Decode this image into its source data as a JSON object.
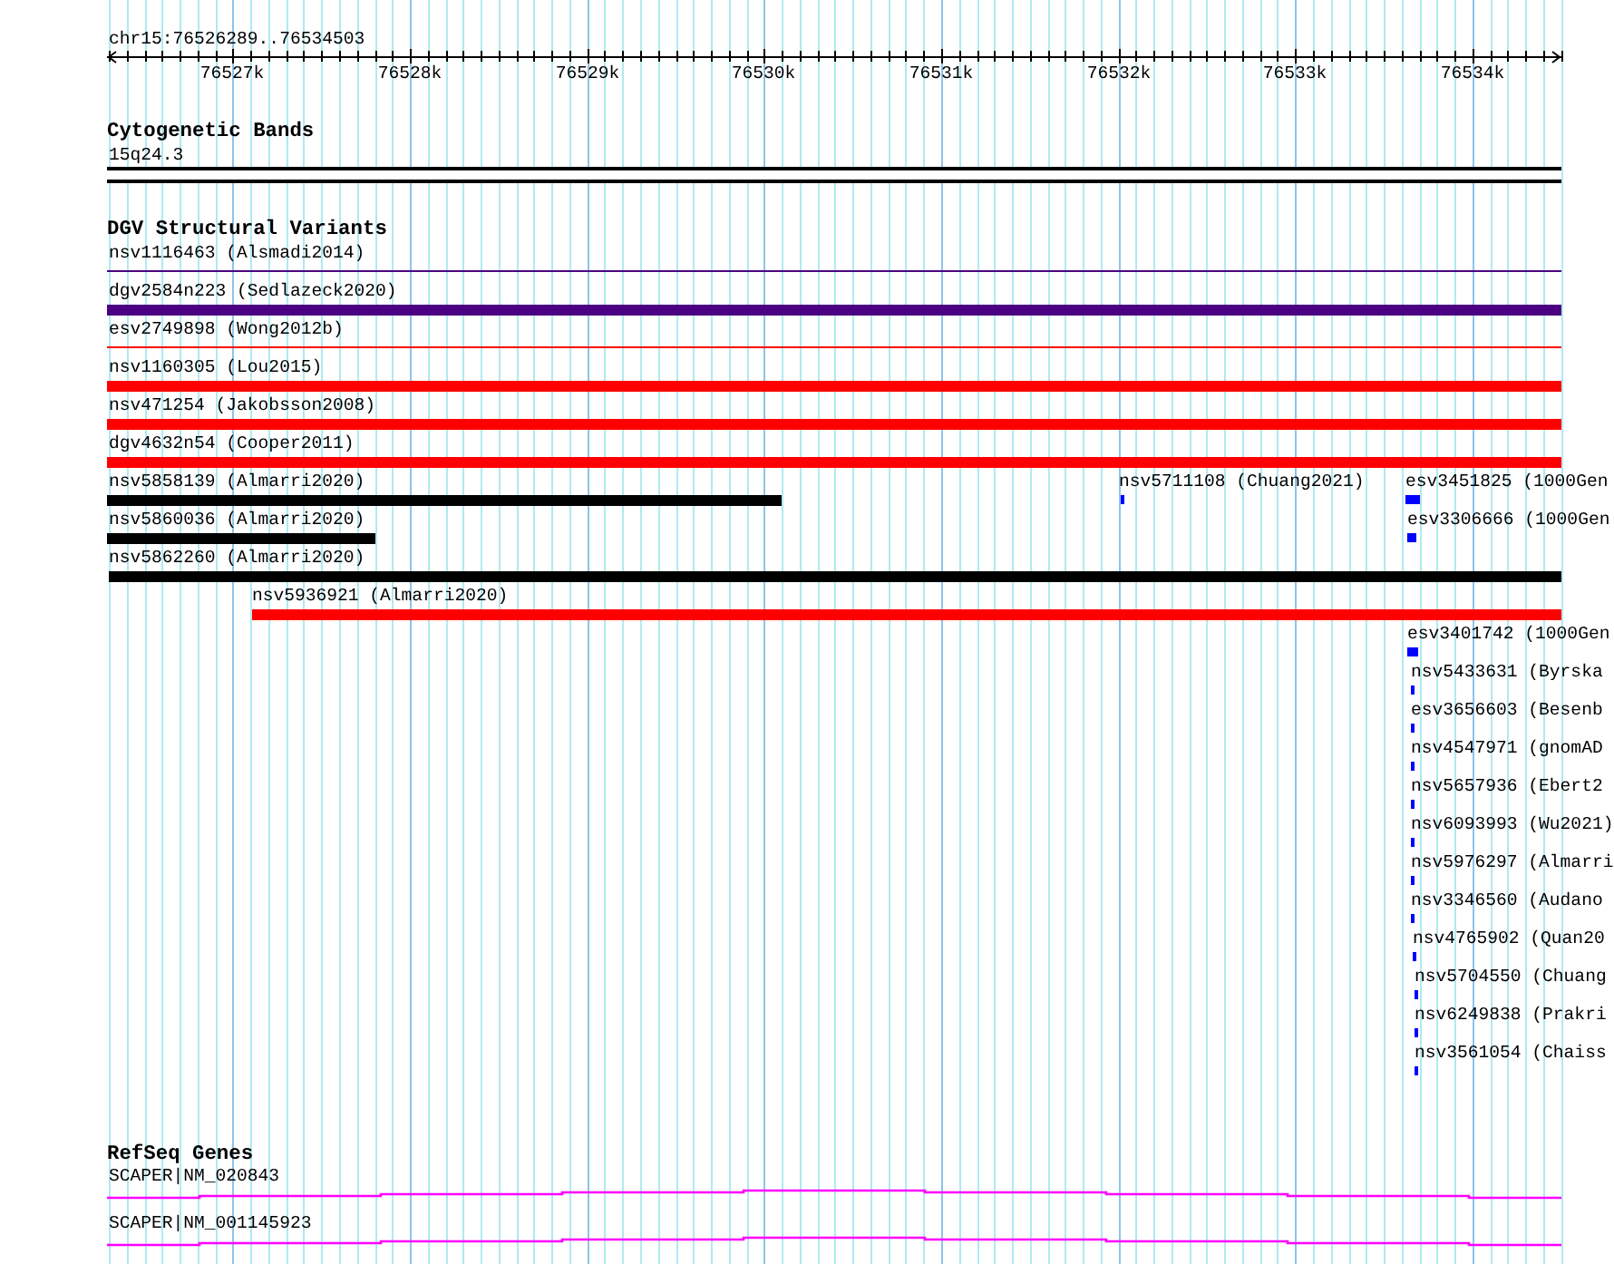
{
  "ruler": {
    "region": "chr15:76526289..76534503",
    "ticks": [
      "76527k",
      "76528k",
      "76529k",
      "76530k",
      "76531k",
      "76532k",
      "76533k",
      "76534k"
    ]
  },
  "tracks": [
    {
      "kind": "cytoband",
      "title": "Cytogenetic Bands",
      "features": [
        {
          "label": "15q24.3"
        }
      ]
    },
    {
      "kind": "variants",
      "title": "DGV Structural Variants",
      "features": [
        {
          "label": "nsv1116463 (Alsmadi2014)",
          "color": "#4b0082"
        },
        {
          "label": "dgv2584n223 (Sedlazeck2020)",
          "color": "#4b0082"
        },
        {
          "label": "esv2749898 (Wong2012b)",
          "color": "#ff0000"
        },
        {
          "label": "nsv1160305 (Lou2015)",
          "color": "#ff0000"
        },
        {
          "label": "nsv471254 (Jakobsson2008)",
          "color": "#ff0000"
        },
        {
          "label": "dgv4632n54 (Cooper2011)",
          "color": "#ff0000"
        },
        {
          "label": "nsv5858139 (Almarri2020)",
          "color": "#000000"
        },
        {
          "label": "nsv5711108 (Chuang2021)",
          "color": "#0000ff"
        },
        {
          "label": "esv3451825 (1000Gen",
          "color": "#0000ff"
        },
        {
          "label": "nsv5860036 (Almarri2020)",
          "color": "#000000"
        },
        {
          "label": "esv3306666 (1000Gen",
          "color": "#0000ff"
        },
        {
          "label": "nsv5862260 (Almarri2020)",
          "color": "#000000"
        },
        {
          "label": "nsv5936921 (Almarri2020)",
          "color": "#ff0000"
        },
        {
          "label": "esv3401742 (1000Gen",
          "color": "#0000ff"
        },
        {
          "label": "nsv5433631 (Byrska",
          "color": "#0000ff"
        },
        {
          "label": "esv3656603 (Besenb",
          "color": "#0000ff"
        },
        {
          "label": "nsv4547971 (gnomAD",
          "color": "#0000ff"
        },
        {
          "label": "nsv5657936 (Ebert2",
          "color": "#0000ff"
        },
        {
          "label": "nsv6093993 (Wu2021)",
          "color": "#0000ff"
        },
        {
          "label": "nsv5976297 (Almarri",
          "color": "#0000ff"
        },
        {
          "label": "nsv3346560 (Audano",
          "color": "#0000ff"
        },
        {
          "label": "nsv4765902 (Quan20",
          "color": "#0000ff"
        },
        {
          "label": "nsv5704550 (Chuang",
          "color": "#0000ff"
        },
        {
          "label": "nsv6249838 (Prakri",
          "color": "#0000ff"
        },
        {
          "label": "nsv3561054 (Chaiss",
          "color": "#0000ff"
        }
      ]
    },
    {
      "kind": "genes",
      "title": "RefSeq Genes",
      "features": [
        {
          "label": "SCAPER|NM_020843",
          "color": "#ff00ff"
        },
        {
          "label": "SCAPER|NM_001145923",
          "color": "#ff00ff"
        }
      ]
    }
  ]
}
